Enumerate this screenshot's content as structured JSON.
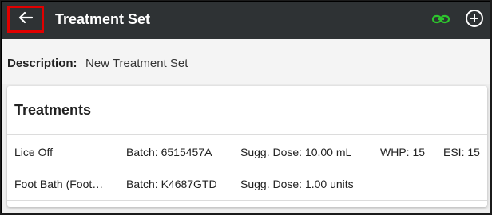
{
  "header": {
    "title": "Treatment Set",
    "back_icon": "arrow-left-icon",
    "link_icon": "link-icon",
    "add_icon": "plus-circle-icon"
  },
  "colors": {
    "appbar": "#2e3234",
    "link_icon": "#2dc52d",
    "highlight": "#e00000"
  },
  "description": {
    "label": "Description:",
    "value": "New Treatment Set"
  },
  "treatments": {
    "title": "Treatments",
    "rows": [
      {
        "name": "Lice Off",
        "batch": "Batch: 6515457A",
        "dose": "Sugg. Dose: 10.00 mL",
        "whp": "WHP: 15",
        "esi": "ESI: 15"
      },
      {
        "name": "Foot Bath (Foot…",
        "batch": "Batch: K4687GTD",
        "dose": "Sugg. Dose: 1.00 units",
        "whp": "",
        "esi": ""
      }
    ]
  }
}
